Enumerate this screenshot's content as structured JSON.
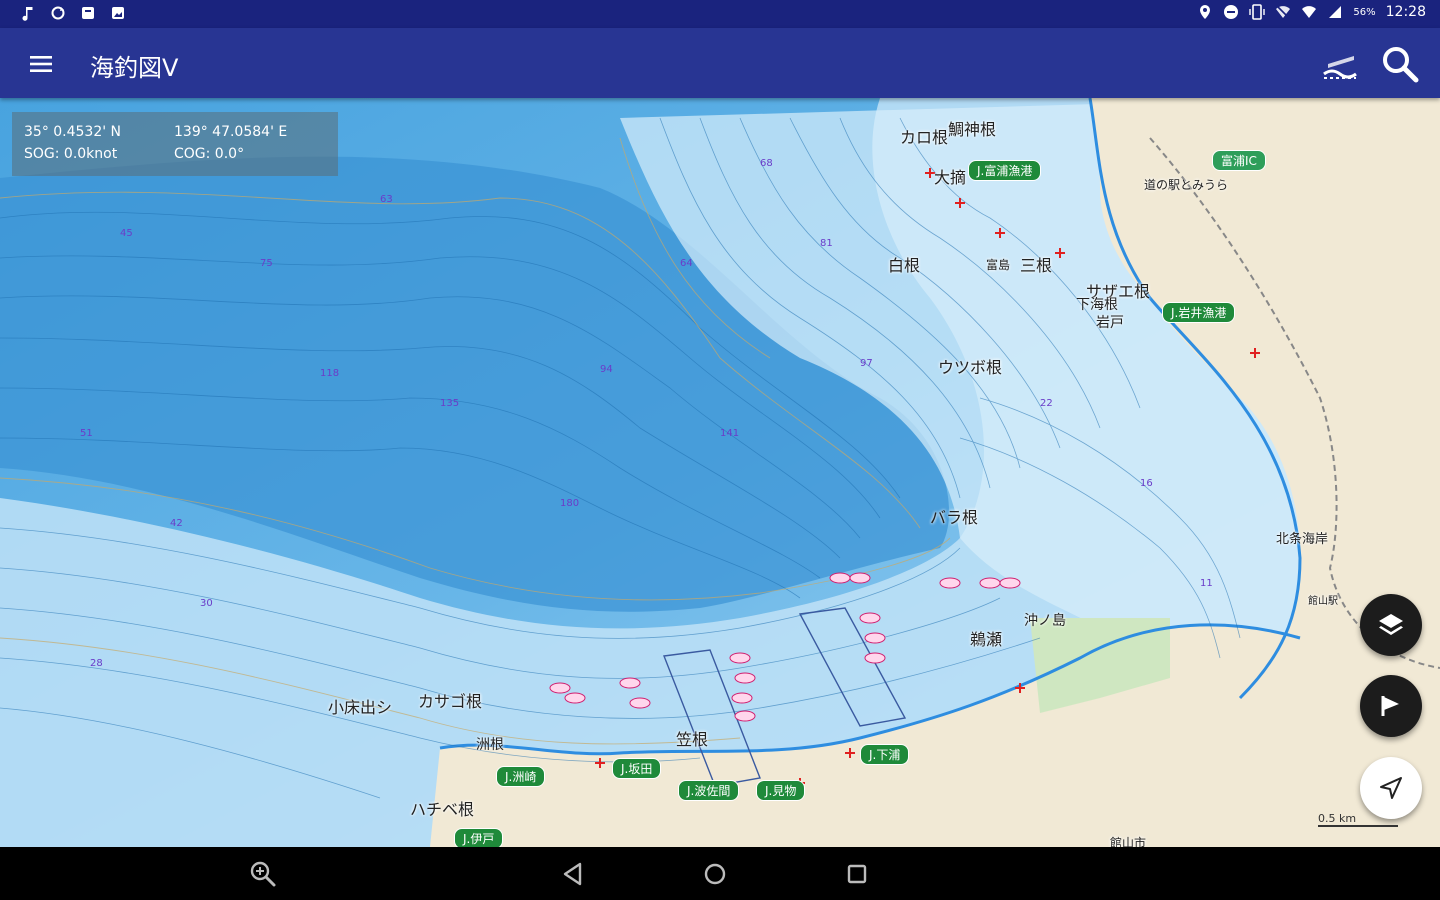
{
  "status_bar": {
    "left_icons": [
      "music-note-icon",
      "sync-icon",
      "notification-icon",
      "image-icon"
    ],
    "right_icons": [
      "location-icon",
      "do-not-disturb-icon",
      "vibrate-icon",
      "wifi-off-icon",
      "wifi-icon",
      "signal-icon"
    ],
    "battery": "56%",
    "time": "12:28"
  },
  "app_bar": {
    "title": "海釣図V"
  },
  "coords": {
    "lat": "35° 0.4532' N",
    "lon": "139° 47.0584' E",
    "sog": "SOG: 0.0knot",
    "cog": "COG: 0.0°"
  },
  "map": {
    "colors": {
      "deep_water": "#3a9ad9",
      "mid_water": "#6fb8e8",
      "shallow_water": "#bfe2f7",
      "land": "#f1e9d5",
      "park": "#cfe7c1",
      "contour": "#1e6fb0",
      "coast": "#2e8de0",
      "depth_text": "#6a3dc9",
      "port": "#1f8a3a"
    },
    "place_labels": [
      {
        "text": "カロ根"
      },
      {
        "text": "鯛神根"
      },
      {
        "text": "大摘"
      },
      {
        "text": "白根"
      },
      {
        "text": "富島"
      },
      {
        "text": "三根"
      },
      {
        "text": "サザエ根"
      },
      {
        "text": "下海根"
      },
      {
        "text": "岩戸"
      },
      {
        "text": "ウツボ根"
      },
      {
        "text": "バラ根"
      },
      {
        "text": "鵜瀬"
      },
      {
        "text": "沖ノ島"
      },
      {
        "text": "小床出シ"
      },
      {
        "text": "カサゴ根"
      },
      {
        "text": "洲根"
      },
      {
        "text": "笠根"
      },
      {
        "text": "ハチベ根"
      },
      {
        "text": "北条海岸"
      },
      {
        "text": "館山駅"
      },
      {
        "text": "富浦IC"
      },
      {
        "text": "道の駅とみうら"
      },
      {
        "text": "館山市"
      }
    ],
    "port_labels": [
      {
        "text": "J.富浦漁港"
      },
      {
        "text": "J.岩井漁港"
      },
      {
        "text": "J.洲崎"
      },
      {
        "text": "J.坂田"
      },
      {
        "text": "J.波佐間"
      },
      {
        "text": "J.見物"
      },
      {
        "text": "J.下浦"
      },
      {
        "text": "J.伊戸"
      }
    ],
    "depth_values": [
      "45",
      "75",
      "63",
      "118",
      "135",
      "94",
      "180",
      "141",
      "51",
      "42",
      "30",
      "28",
      "64",
      "97",
      "68",
      "81",
      "22",
      "16",
      "11"
    ],
    "scale_label": "0.5 km"
  },
  "fabs": {
    "layers": "layers-icon",
    "track": "flag-icon",
    "locate": "navigation-arrow-icon"
  },
  "nav_bar": {
    "buttons": [
      "zoom-icon",
      "back-icon",
      "home-icon",
      "recents-icon"
    ]
  }
}
